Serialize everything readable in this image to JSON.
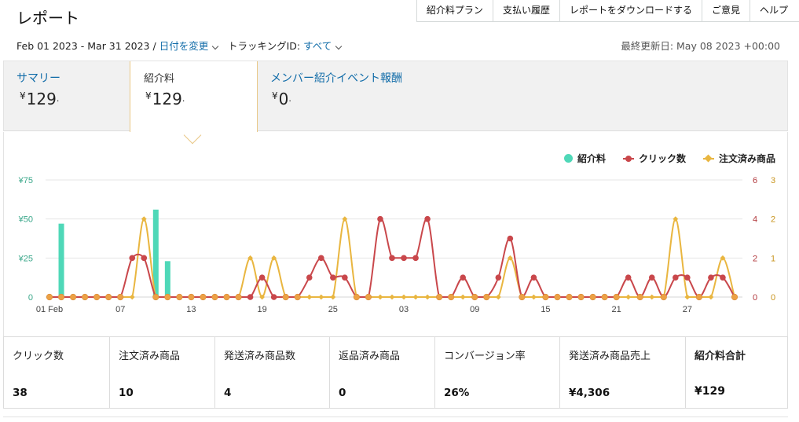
{
  "page": {
    "title": "レポート"
  },
  "topnav": [
    "紹介料プラン",
    "支払い履歴",
    "レポートをダウンロードする",
    "ご意見",
    "ヘルプ"
  ],
  "filter": {
    "date_range": "Feb 01 2023 - Mar 31 2023",
    "separator": " / ",
    "change_date": "日付を変更",
    "tracking_label": "トラッキングID: ",
    "tracking_value": "すべて",
    "last_updated": "最終更新日: May 08 2023 +00:00"
  },
  "summary_tabs": [
    {
      "label": "サマリー",
      "currency": "¥",
      "amount": "129",
      "suffix": "."
    },
    {
      "label": "紹介料",
      "currency": "¥",
      "amount": "129",
      "suffix": ".",
      "active": true
    },
    {
      "label": "メンバー紹介イベント報酬",
      "currency": "¥",
      "amount": "0",
      "suffix": "."
    }
  ],
  "colors": {
    "fee": "#4fd8b8",
    "clicks": "#c9474b",
    "ordered": "#e9b640",
    "link": "#0f6ba8"
  },
  "chart_data": {
    "type": "bar+line",
    "legend": [
      "紹介料",
      "クリック数",
      "注文済み商品"
    ],
    "legend_position": "top-right",
    "x_categories": [
      "02-01",
      "02-02",
      "02-03",
      "02-04",
      "02-05",
      "02-06",
      "02-07",
      "02-08",
      "02-09",
      "02-10",
      "02-11",
      "02-12",
      "02-13",
      "02-14",
      "02-15",
      "02-16",
      "02-17",
      "02-18",
      "02-19",
      "02-20",
      "02-21",
      "02-22",
      "02-23",
      "02-24",
      "02-25",
      "02-26",
      "02-27",
      "02-28",
      "03-01",
      "03-02",
      "03-03",
      "03-04",
      "03-05",
      "03-06",
      "03-07",
      "03-08",
      "03-09",
      "03-10",
      "03-11",
      "03-12",
      "03-13",
      "03-14",
      "03-15",
      "03-16",
      "03-17",
      "03-18",
      "03-19",
      "03-20",
      "03-21",
      "03-22",
      "03-23",
      "03-24",
      "03-25",
      "03-26",
      "03-27",
      "03-28",
      "03-29",
      "03-30",
      "03-31"
    ],
    "x_tick_labels": [
      "01 Feb",
      "07",
      "13",
      "19",
      "25",
      "03",
      "09",
      "15",
      "21",
      "27"
    ],
    "y_left": {
      "ticks": [
        "0",
        "¥25",
        "¥50",
        "¥75"
      ],
      "range": [
        0,
        75
      ]
    },
    "y_right_clicks": {
      "ticks": [
        "0",
        "2",
        "4",
        "6"
      ],
      "range": [
        0,
        6
      ]
    },
    "y_right_ordered": {
      "ticks": [
        "0",
        "1",
        "2",
        "3"
      ],
      "range": [
        0,
        3
      ]
    },
    "grid": true,
    "series": [
      {
        "name": "紹介料",
        "type": "bar",
        "axis": "left",
        "values": [
          0,
          47,
          0,
          0,
          0,
          0,
          0,
          0,
          0,
          56,
          23,
          0,
          0,
          0,
          0,
          0,
          0,
          0,
          0,
          0,
          0,
          0,
          0,
          0,
          0,
          0,
          0,
          0,
          0,
          0,
          0,
          0,
          0,
          0,
          0,
          0,
          0,
          0,
          0,
          0,
          0,
          0,
          0,
          0,
          0,
          0,
          0,
          0,
          0,
          0,
          0,
          0,
          0,
          0,
          0,
          0,
          0,
          0,
          0
        ]
      },
      {
        "name": "クリック数",
        "type": "line",
        "axis": "right_clicks",
        "values": [
          0,
          0,
          0,
          0,
          0,
          0,
          0,
          2,
          2,
          0,
          0,
          0,
          0,
          0,
          0,
          0,
          0,
          0,
          1,
          0,
          0,
          0,
          1,
          2,
          1,
          1,
          0,
          0,
          4,
          2,
          2,
          2,
          4,
          0,
          0,
          1,
          0,
          0,
          1,
          3,
          0,
          1,
          0,
          0,
          0,
          0,
          0,
          0,
          0,
          1,
          0,
          1,
          0,
          1,
          1,
          0,
          1,
          1,
          0
        ]
      },
      {
        "name": "注文済み商品",
        "type": "line",
        "axis": "right_ordered",
        "values": [
          0,
          0,
          0,
          0,
          0,
          0,
          0,
          0,
          2,
          0,
          0,
          0,
          0,
          0,
          0,
          0,
          0,
          1,
          0,
          1,
          0,
          0,
          0,
          0,
          0,
          2,
          0,
          0,
          0,
          0,
          0,
          0,
          0,
          0,
          0,
          0,
          0,
          0,
          0,
          1,
          0,
          0,
          0,
          0,
          0,
          0,
          0,
          0,
          0,
          0,
          0,
          0,
          0,
          2,
          0,
          0,
          0,
          1,
          0
        ]
      }
    ]
  },
  "metrics": [
    {
      "label": "クリック数",
      "value": "38"
    },
    {
      "label": "注文済み商品",
      "value": "10"
    },
    {
      "label": "発送済み商品数",
      "value": "4"
    },
    {
      "label": "返品済み商品",
      "value": "0"
    },
    {
      "label": "コンバージョン率",
      "value": "26%"
    },
    {
      "label": "発送済み商品売上",
      "value": "¥4,306"
    },
    {
      "label": "紹介料合計",
      "value": "¥129"
    }
  ]
}
